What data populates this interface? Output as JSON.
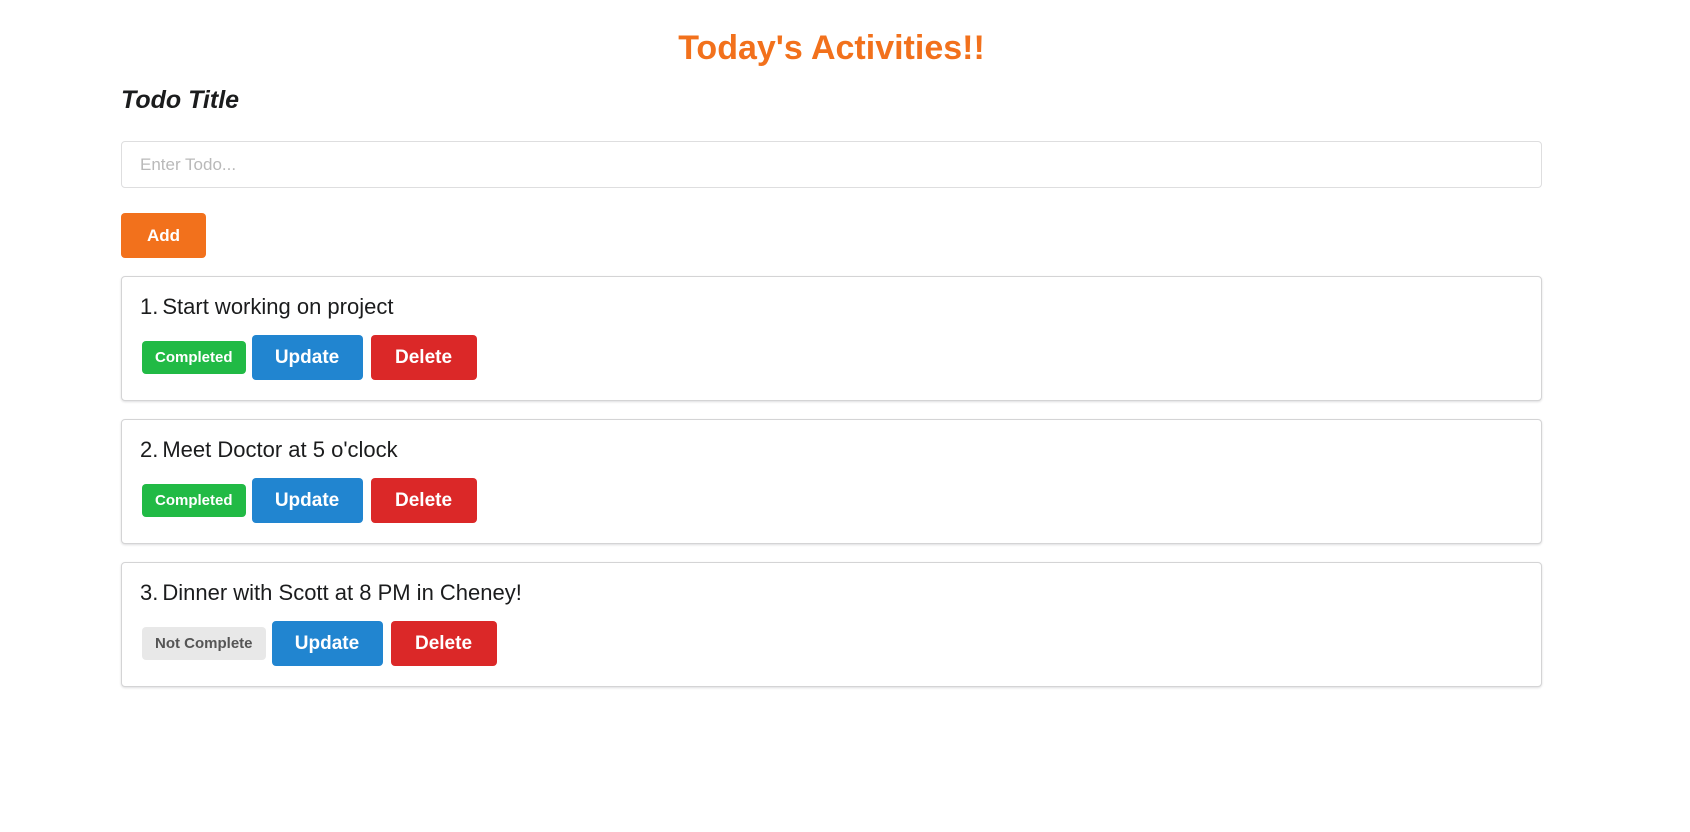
{
  "header": {
    "title": "Today's Activities!!"
  },
  "form": {
    "label": "Todo Title",
    "input_value": "",
    "input_placeholder": "Enter Todo...",
    "add_label": "Add"
  },
  "todos": [
    {
      "number": "1.",
      "title": "Start working on project",
      "status": "Completed",
      "completed": true,
      "update_label": "Update",
      "delete_label": "Delete"
    },
    {
      "number": "2.",
      "title": "Meet Doctor at 5 o'clock",
      "status": "Completed",
      "completed": true,
      "update_label": "Update",
      "delete_label": "Delete"
    },
    {
      "number": "3.",
      "title": "Dinner with Scott at 8 PM in Cheney!",
      "status": "Not Complete",
      "completed": false,
      "update_label": "Update",
      "delete_label": "Delete"
    }
  ],
  "colors": {
    "title": "#f2711c",
    "add_button": "#f2711c",
    "completed_badge": "#21ba45",
    "not_complete_badge": "#e8e8e8",
    "update_button": "#2185d0",
    "delete_button": "#db2828"
  }
}
